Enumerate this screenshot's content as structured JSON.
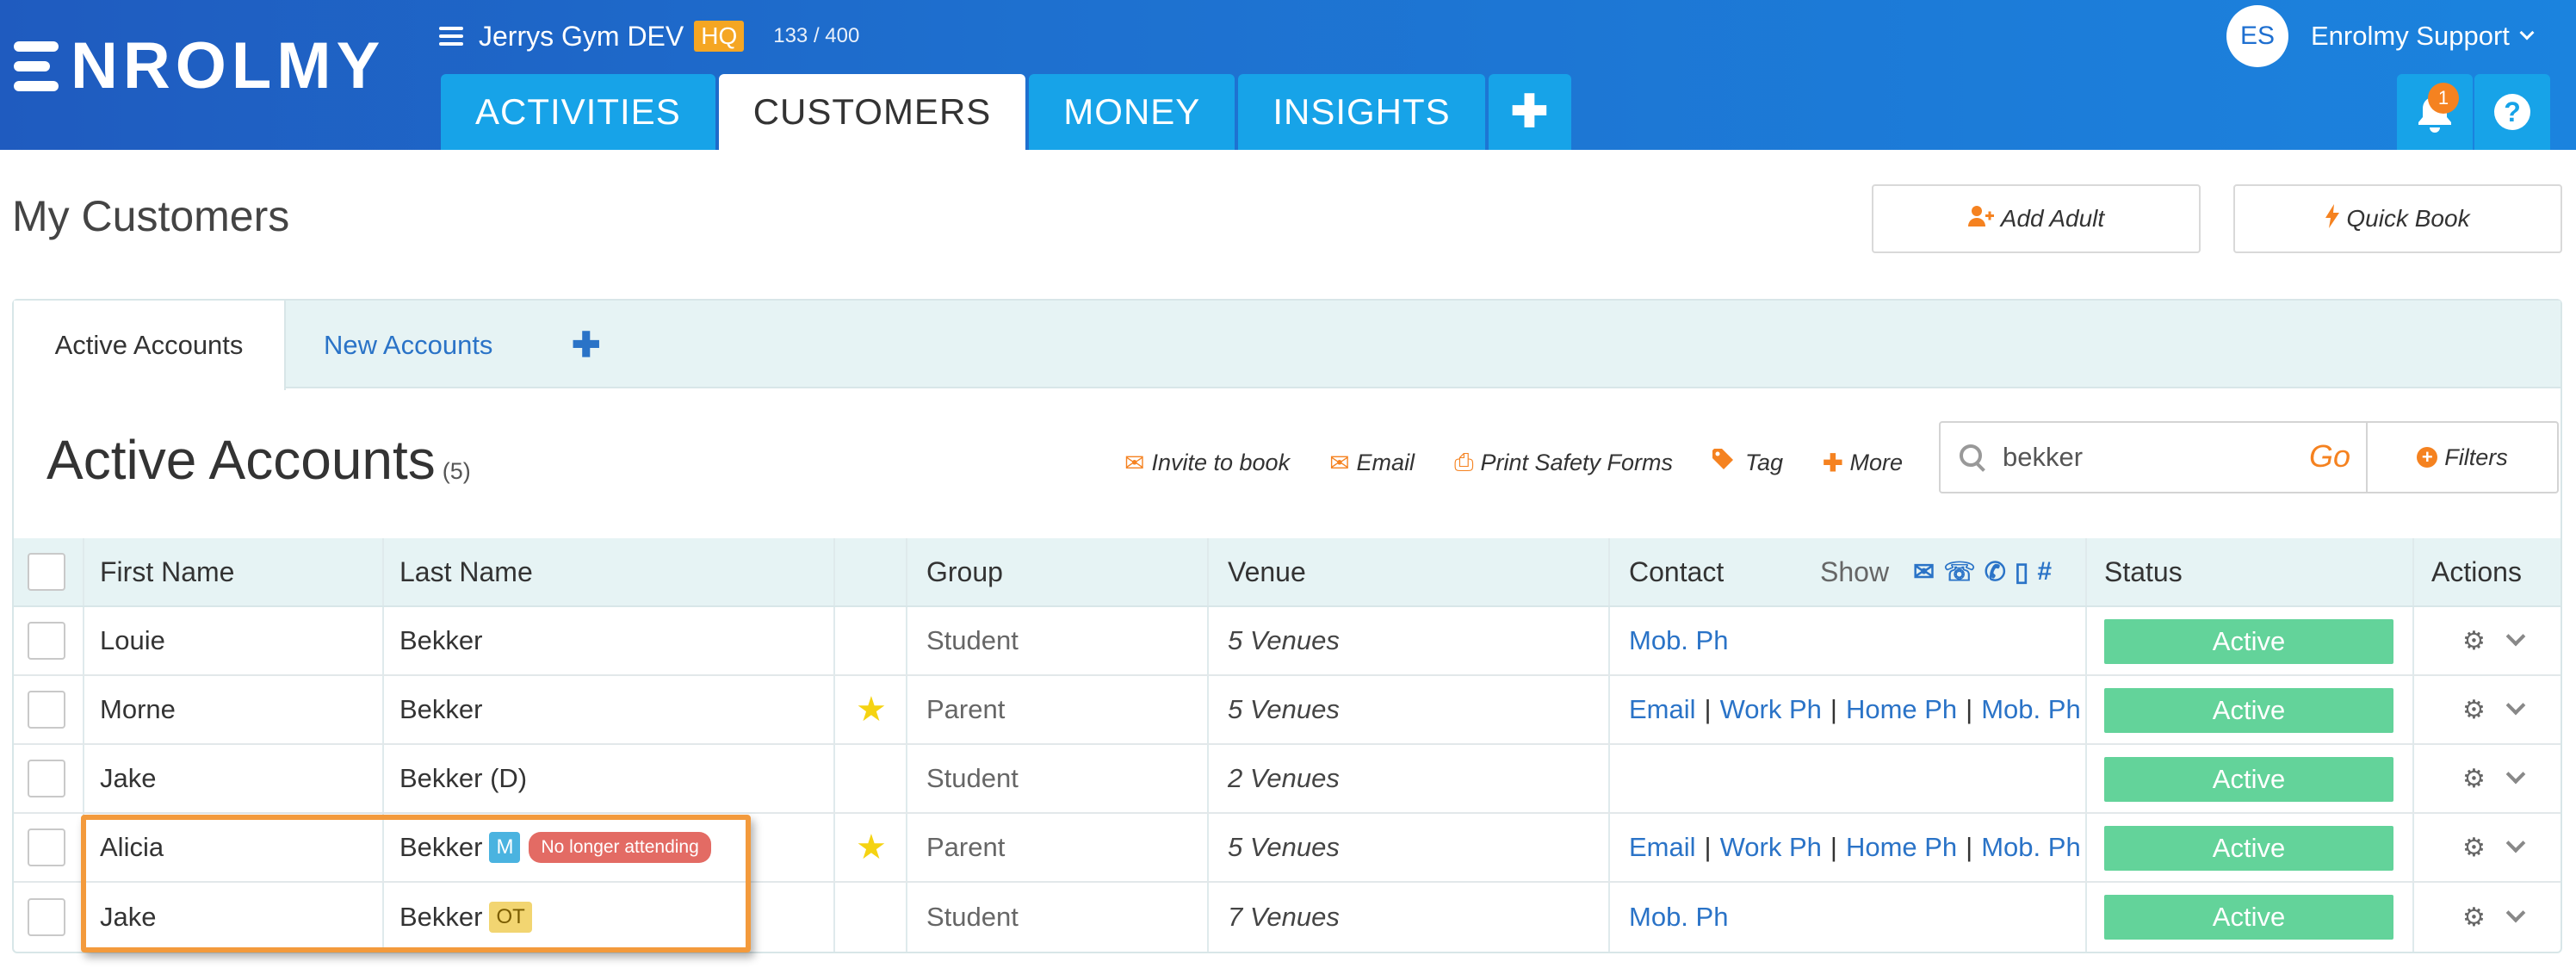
{
  "app": {
    "logo": "ENROLMY"
  },
  "org": {
    "name": "Jerrys Gym DEV",
    "badge": "HQ",
    "count": "133 / 400"
  },
  "tabs": [
    {
      "label": "ACTIVITIES"
    },
    {
      "label": "CUSTOMERS"
    },
    {
      "label": "MONEY"
    },
    {
      "label": "INSIGHTS"
    },
    {
      "label": "✚"
    }
  ],
  "user": {
    "initials": "ES",
    "name": "Enrolmy Support"
  },
  "notifications": {
    "count": "1"
  },
  "help": {
    "label": "?"
  },
  "page": {
    "title": "My Customers"
  },
  "buttons": {
    "add_adult": "Add Adult",
    "quick_book": "Quick Book"
  },
  "subtabs": {
    "active": "Active Accounts",
    "new": "New Accounts",
    "add": "✚"
  },
  "section": {
    "title": "Active Accounts",
    "count": "(5)"
  },
  "toolbar": {
    "invite": "Invite to book",
    "email": "Email",
    "print": "Print Safety Forms",
    "tag": "Tag",
    "more": "More"
  },
  "search": {
    "value": "bekker",
    "go": "Go"
  },
  "filters": {
    "label": "Filters"
  },
  "columns": {
    "first": "First Name",
    "last": "Last Name",
    "group": "Group",
    "venue": "Venue",
    "contact": "Contact",
    "show": "Show",
    "status": "Status",
    "actions": "Actions"
  },
  "rows": [
    {
      "first": "Louie",
      "last": "Bekker",
      "group": "Student",
      "venue": "5 Venues",
      "contacts": [
        "Mob. Ph"
      ],
      "status": "Active"
    },
    {
      "first": "Morne",
      "last": "Bekker",
      "group": "Parent",
      "venue": "5 Venues",
      "contacts": [
        "Email",
        "Work Ph",
        "Home Ph",
        "Mob. Ph"
      ],
      "status": "Active",
      "starred": true
    },
    {
      "first": "Jake",
      "last": "Bekker (D)",
      "group": "Student",
      "venue": "2 Venues",
      "contacts": [],
      "status": "Active"
    },
    {
      "first": "Alicia",
      "last": "Bekker",
      "tag": "M",
      "tag2": "No longer attending",
      "group": "Parent",
      "venue": "5 Venues",
      "contacts": [
        "Email",
        "Work Ph",
        "Home Ph",
        "Mob. Ph"
      ],
      "status": "Active",
      "starred": true
    },
    {
      "first": "Jake",
      "last": "Bekker",
      "tag": "OT",
      "group": "Student",
      "venue": "7 Venues",
      "contacts": [
        "Mob. Ph"
      ],
      "status": "Active"
    }
  ],
  "colors": {
    "header": "#1e70cf",
    "tab": "#17a3e8",
    "accent": "#f58220",
    "active_status": "#63d39a",
    "link": "#2a73c7",
    "highlight": "#f39a3c"
  }
}
